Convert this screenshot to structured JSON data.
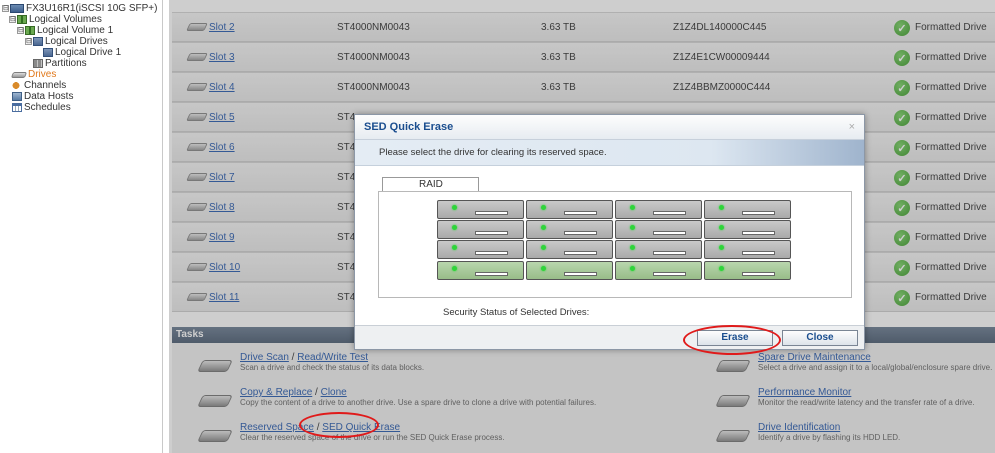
{
  "tree": {
    "items": [
      {
        "label": "FX3U16R1(iSCSI 10G SFP+)",
        "expander": "⊟",
        "icon": "server-icon"
      },
      {
        "label": "Logical Volumes",
        "expander": "⊟",
        "icon": "volume-icon"
      },
      {
        "label": "Logical Volume 1",
        "expander": "⊟",
        "icon": "volume-icon"
      },
      {
        "label": "Logical Drives",
        "expander": "⊟",
        "icon": "drive-icon"
      },
      {
        "label": "Logical Drive 1",
        "expander": "",
        "icon": "drive-icon"
      },
      {
        "label": "Partitions",
        "expander": "",
        "icon": "partition-icon"
      },
      {
        "label": "Drives",
        "expander": "",
        "icon": "disk-icon"
      },
      {
        "label": "Channels",
        "expander": "",
        "icon": "channel-icon"
      },
      {
        "label": "Data Hosts",
        "expander": "",
        "icon": "host-icon"
      },
      {
        "label": "Schedules",
        "expander": "",
        "icon": "schedule-icon"
      }
    ]
  },
  "drives": [
    {
      "slot": "Slot 2",
      "model": "ST4000NM0043",
      "size": "3.63 TB",
      "serial": "Z1Z4DL140000C445",
      "status": "Formatted Drive"
    },
    {
      "slot": "Slot 3",
      "model": "ST4000NM0043",
      "size": "3.63 TB",
      "serial": "Z1Z4E1CW00009444",
      "status": "Formatted Drive"
    },
    {
      "slot": "Slot 4",
      "model": "ST4000NM0043",
      "size": "3.63 TB",
      "serial": "Z1Z4BBMZ0000C444",
      "status": "Formatted Drive"
    },
    {
      "slot": "Slot 5",
      "model": "ST4",
      "size": "",
      "serial": "",
      "status": "Formatted Drive"
    },
    {
      "slot": "Slot 6",
      "model": "ST4",
      "size": "",
      "serial": "",
      "status": "Formatted Drive"
    },
    {
      "slot": "Slot 7",
      "model": "ST4",
      "size": "",
      "serial": "",
      "status": "Formatted Drive"
    },
    {
      "slot": "Slot 8",
      "model": "ST4",
      "size": "",
      "serial": "",
      "status": "Formatted Drive"
    },
    {
      "slot": "Slot 9",
      "model": "ST4",
      "size": "",
      "serial": "",
      "status": "Formatted Drive"
    },
    {
      "slot": "Slot 10",
      "model": "ST4",
      "size": "",
      "serial": "",
      "status": "Formatted Drive"
    },
    {
      "slot": "Slot 11",
      "model": "ST4",
      "size": "",
      "serial": "",
      "status": "Formatted Drive"
    }
  ],
  "tasks": {
    "header": "Tasks",
    "items": [
      {
        "link1": "Drive Scan",
        "sep": " / ",
        "link2": "Read/Write Test",
        "desc": "Scan a drive and check the status of its data blocks."
      },
      {
        "link1": "Copy & Replace",
        "sep": " / ",
        "link2": "Clone",
        "desc": "Copy the content of a drive to another drive. Use a spare drive to clone a drive with potential failures."
      },
      {
        "link1": "Reserved Space",
        "sep": " / ",
        "link2": "SED Quick Erase",
        "desc": "Clear the reserved space of the drive or run the SED Quick Erase process."
      },
      {
        "link1": "Spare Drive Maintenance",
        "sep": "",
        "link2": "",
        "desc": "Select a drive and assign it to a local/global/enclosure spare drive."
      },
      {
        "link1": "Performance Monitor",
        "sep": "",
        "link2": "",
        "desc": "Monitor the read/write latency and the transfer rate of a drive."
      },
      {
        "link1": "Drive Identification",
        "sep": "",
        "link2": "",
        "desc": "Identify a drive by flashing its HDD LED."
      }
    ]
  },
  "dialog": {
    "title": "SED Quick Erase",
    "close_glyph": "×",
    "message": "Please select the drive for clearing its reserved space.",
    "tab_label": "RAID",
    "bays": [
      {
        "selected": false
      },
      {
        "selected": false
      },
      {
        "selected": false
      },
      {
        "selected": false
      },
      {
        "selected": false
      },
      {
        "selected": false
      },
      {
        "selected": false
      },
      {
        "selected": false
      },
      {
        "selected": false
      },
      {
        "selected": false
      },
      {
        "selected": false
      },
      {
        "selected": false
      },
      {
        "selected": true
      },
      {
        "selected": true
      },
      {
        "selected": true
      },
      {
        "selected": true
      }
    ],
    "security_status_label": "Security Status of Selected Drives:",
    "erase_label": "Erase",
    "close_label": "Close"
  },
  "colors": {
    "link": "#2a5db0",
    "selected_tree": "#e0781b",
    "annotation": "#e01a1a",
    "status_ok": "#3c9c2a"
  }
}
